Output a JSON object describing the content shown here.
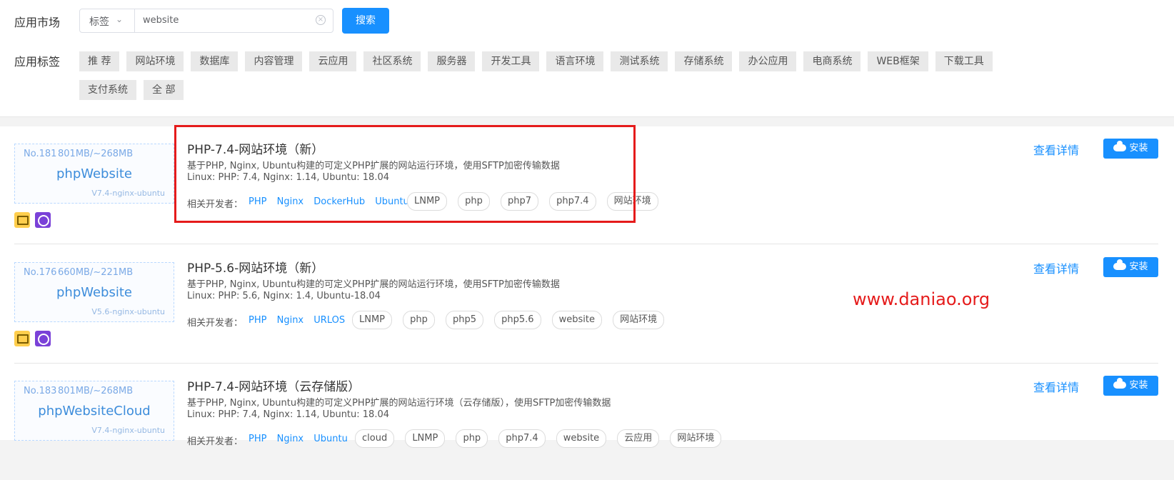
{
  "header": {
    "market_label": "应用市场",
    "tags_label": "应用标签",
    "search": {
      "select_value": "标签",
      "value": "website",
      "button": "搜索"
    },
    "tags": [
      "推 荐",
      "网站环境",
      "数据库",
      "内容管理",
      "云应用",
      "社区系统",
      "服务器",
      "开发工具",
      "语言环境",
      "测试系统",
      "存储系统",
      "办公应用",
      "电商系统",
      "WEB框架",
      "下载工具",
      "支付系统",
      "全 部"
    ]
  },
  "cards": [
    {
      "no": "No.181",
      "size": "801MB/~268MB",
      "name": "phpWebsite",
      "version": "V7.4-nginx-ubuntu",
      "title": "PHP-7.4-网站环境（新）",
      "desc": "基于PHP, Nginx, Ubuntu构建的可定义PHP扩展的网站运行环境，使用SFTP加密传输数据",
      "versions": "Linux: PHP: 7.4, Nginx: 1.14, Ubuntu: 18.04",
      "dev_label": "相关开发者：",
      "devs": [
        "PHP",
        "Nginx",
        "DockerHub",
        "Ubuntu"
      ],
      "chips": [
        "LNMP",
        "php",
        "php7",
        "php7.4",
        "网站环境"
      ],
      "detail": "查看详情",
      "install": "安装"
    },
    {
      "no": "No.176",
      "size": "660MB/~221MB",
      "name": "phpWebsite",
      "version": "V5.6-nginx-ubuntu",
      "title": "PHP-5.6-网站环境（新）",
      "desc": "基于PHP, Nginx, Ubuntu构建的可定义PHP扩展的网站运行环境，使用SFTP加密传输数据",
      "versions": "Linux: PHP: 5.6, Nginx: 1.4, Ubuntu-18.04",
      "dev_label": "相关开发者：",
      "devs": [
        "PHP",
        "Nginx",
        "URLOS"
      ],
      "chips": [
        "LNMP",
        "php",
        "php5",
        "php5.6",
        "website",
        "网站环境"
      ],
      "detail": "查看详情",
      "install": "安装"
    },
    {
      "no": "No.183",
      "size": "801MB/~268MB",
      "name": "phpWebsiteCloud",
      "version": "V7.4-nginx-ubuntu",
      "title": "PHP-7.4-网站环境（云存储版）",
      "desc": "基于PHP, Nginx, Ubuntu构建的可定义PHP扩展的网站运行环境（云存储版），使用SFTP加密传输数据",
      "versions": "Linux: PHP: 7.4, Nginx: 1.14, Ubuntu: 18.04",
      "dev_label": "相关开发者：",
      "devs": [
        "PHP",
        "Nginx",
        "Ubuntu"
      ],
      "chips": [
        "cloud",
        "LNMP",
        "php",
        "php7.4",
        "website",
        "云应用",
        "网站环境"
      ],
      "detail": "查看详情",
      "install": "安装"
    }
  ],
  "watermark": "www.daniao.org",
  "colors": {
    "primary": "#1890ff",
    "highlight": "#e51b1b",
    "tag_bg": "#e9e9e9"
  }
}
